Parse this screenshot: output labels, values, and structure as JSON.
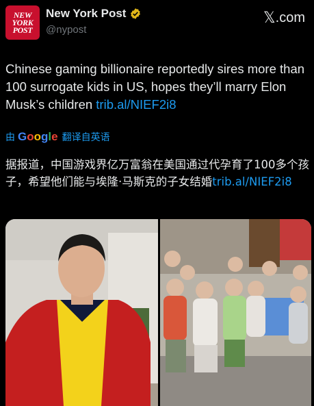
{
  "header": {
    "publisher_name": "New York Post",
    "handle": "@nypost",
    "avatar_lines": [
      "NEW",
      "YORK",
      "POST"
    ],
    "site_label": ".com"
  },
  "tweet": {
    "text": "Chinese gaming billionaire reportedly sires more than 100 surrogate kids in US, hopes they’ll marry Elon Musk’s children ",
    "link": "trib.al/NIEF2i8"
  },
  "translation": {
    "by": "由",
    "google": [
      "G",
      "o",
      "o",
      "g",
      "l",
      "e"
    ],
    "label": "翻译自英语",
    "text": "据报道，中国游戏界亿万富翁在美国通过代孕育了100多个孩子，希望他们能与埃隆·马斯克的子女结婚",
    "link": "trib.al/NIEF2i8"
  },
  "colors": {
    "link": "#1d9bf0",
    "brand_red": "#c8102e",
    "verified_gold": "#e2b719",
    "background": "#000000"
  },
  "icons": {
    "verified": "verified-badge-icon",
    "x": "x-logo-icon"
  }
}
